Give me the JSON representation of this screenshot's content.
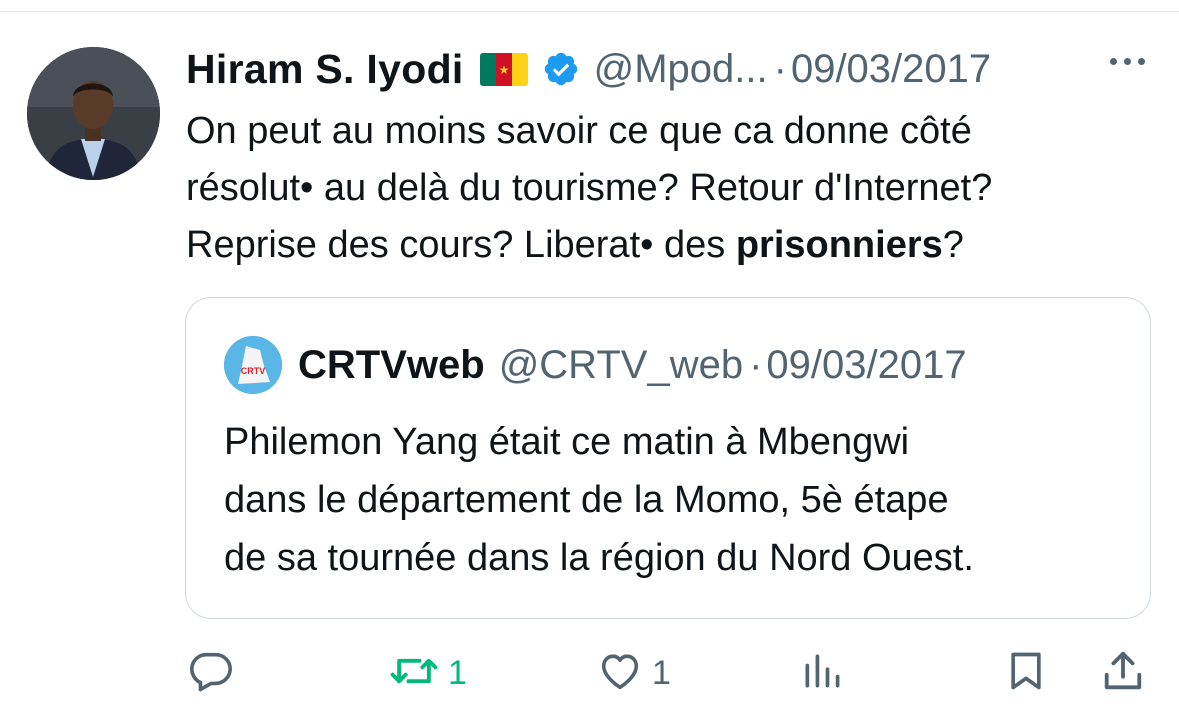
{
  "tweet": {
    "author_name": "Hiram S. Iyodi",
    "handle": "@Mpod...",
    "separator": "·",
    "date": "09/03/2017",
    "text_lines": [
      "On peut au moins savoir ce que ca donne côté",
      "résolut• au delà du tourisme? Retour d'Internet?"
    ],
    "line3_prefix": "Reprise des cours? Liberat• des ",
    "line3_bold": "prisonniers",
    "line3_suffix": "?"
  },
  "quoted_tweet": {
    "author_name": "CRTVweb",
    "handle": "@CRTV_web",
    "separator": "·",
    "date": "09/03/2017",
    "avatar_text": "CRTV",
    "text_lines": [
      "Philemon Yang était ce matin à Mbengwi",
      "dans le département de la Momo, 5è étape",
      "de sa tournée dans la région du Nord Ouest."
    ]
  },
  "actions": {
    "replies": "",
    "retweets": "1",
    "likes": "1"
  },
  "icons": {
    "flag": "cameroon-flag-icon",
    "verified": "verified-badge-icon",
    "more": "more-icon",
    "reply": "reply-icon",
    "retweet": "retweet-icon",
    "like": "heart-icon",
    "views": "views-icon",
    "bookmark": "bookmark-icon",
    "share": "share-icon"
  },
  "colors": {
    "text": "#0f1419",
    "secondary": "#536471",
    "verified_blue": "#1d9bf0",
    "retweet_green": "#00ba7c",
    "border": "#cfd9de",
    "flag_green": "#007a5e",
    "flag_red": "#ce1126",
    "flag_yellow": "#fcd116"
  }
}
